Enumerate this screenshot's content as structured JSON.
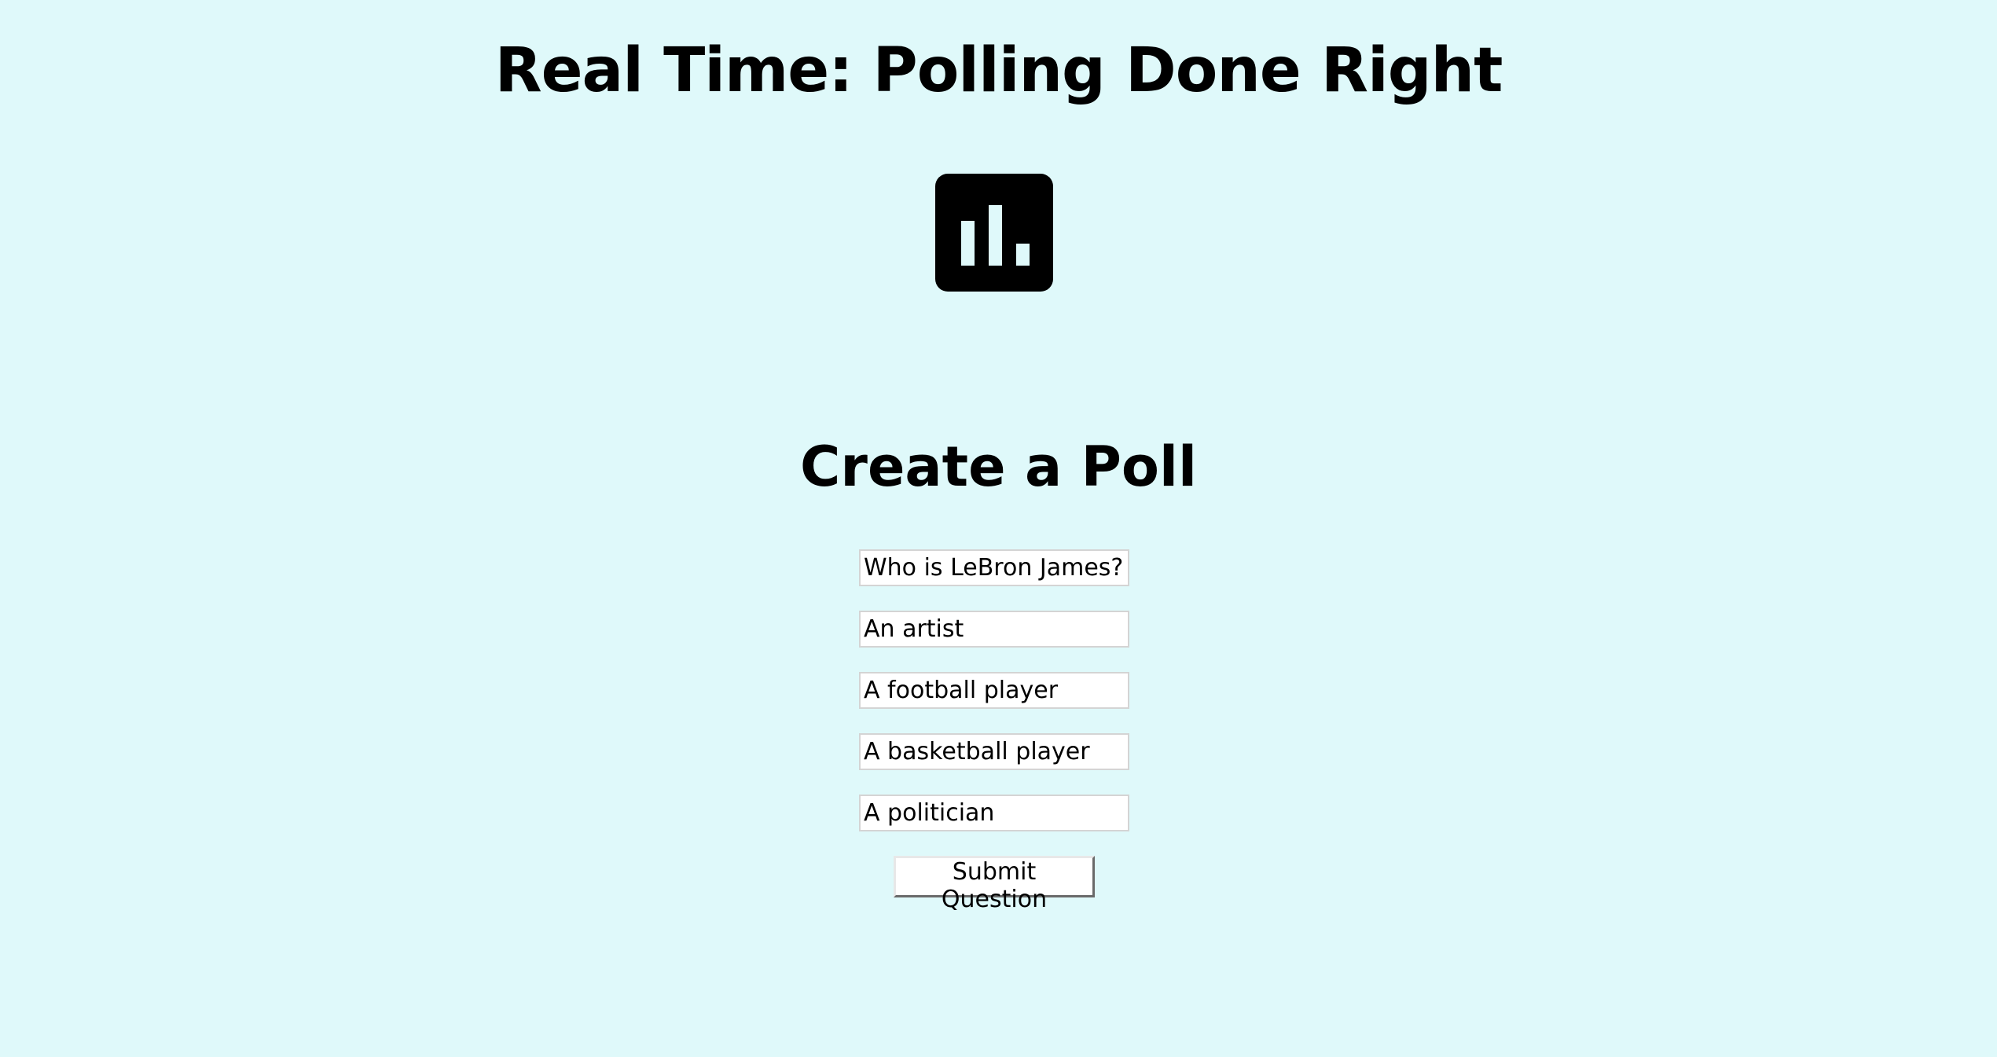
{
  "header": {
    "title": "Real Time: Polling Done Right",
    "logo_icon": "bar-chart-icon"
  },
  "poll": {
    "heading": "Create a Poll",
    "question": {
      "value": "Who is LeBron James?"
    },
    "options": [
      {
        "value": "An artist"
      },
      {
        "value": "A football player"
      },
      {
        "value": "A basketball player"
      },
      {
        "value": "A politician"
      }
    ],
    "submit_label": "Submit Question"
  },
  "colors": {
    "background": "#dff9fa",
    "text": "#000000",
    "input_background": "#ffffff"
  }
}
